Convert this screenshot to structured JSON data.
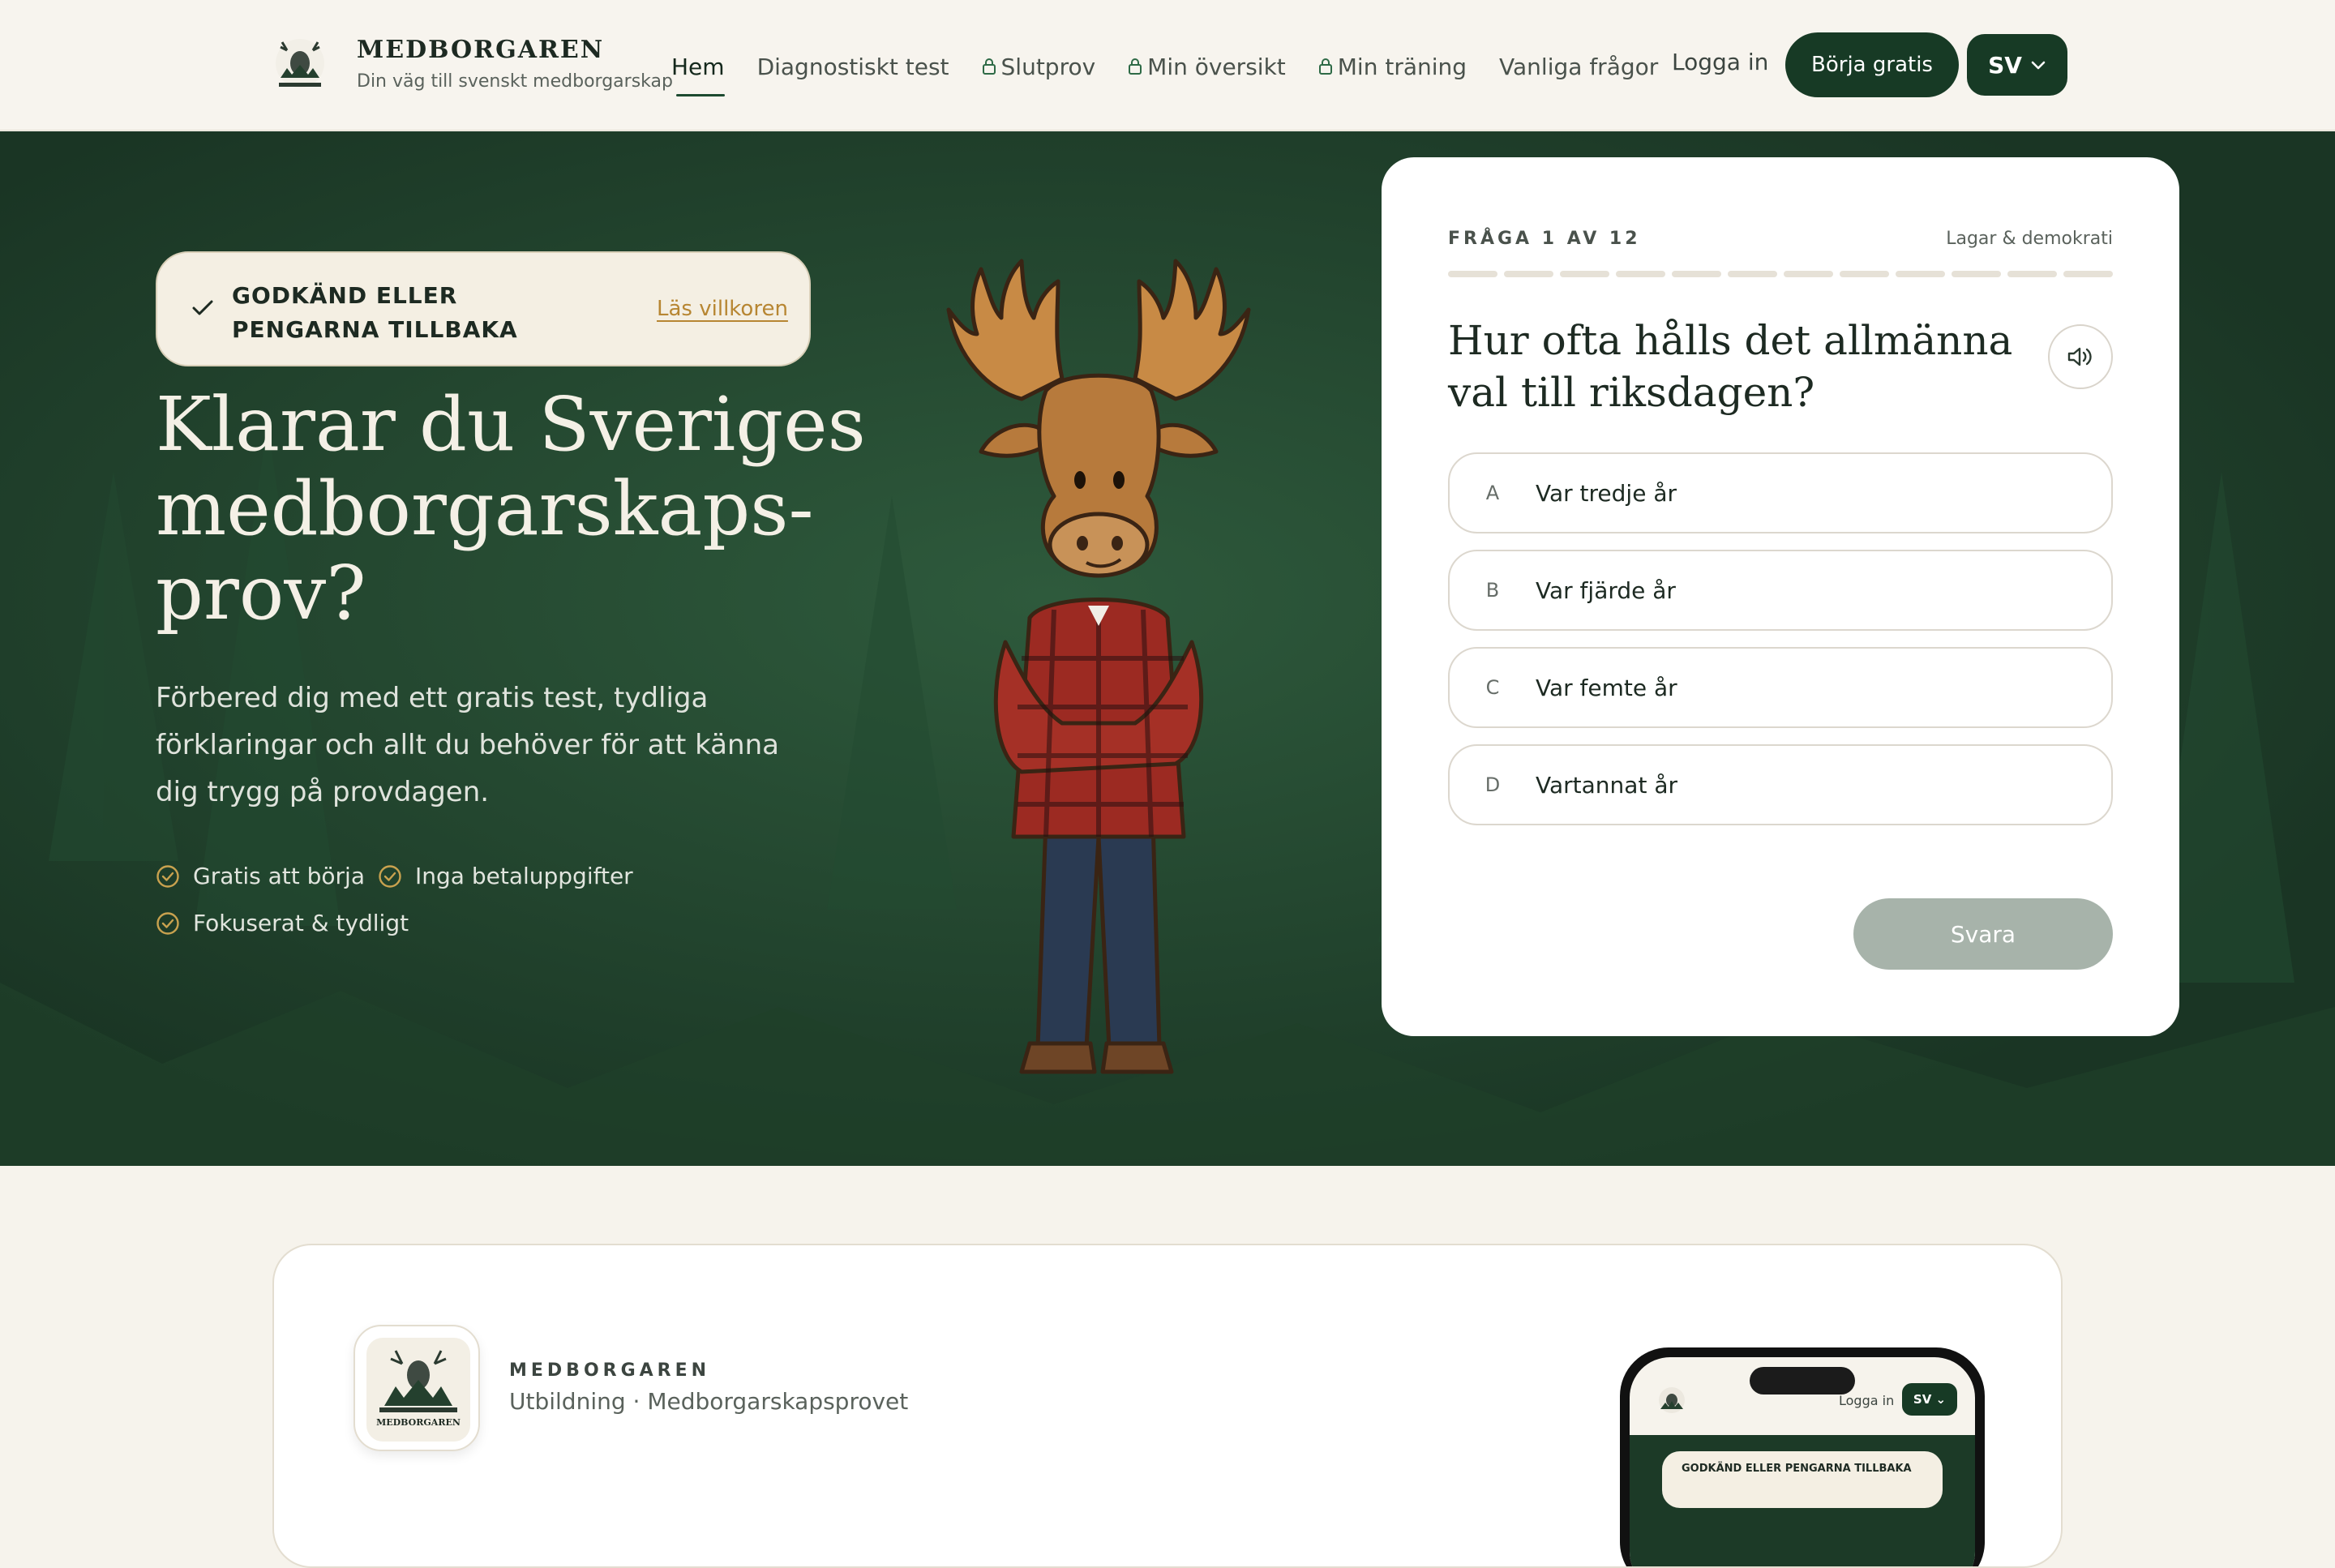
{
  "brand": {
    "name": "MEDBORGAREN",
    "tagline": "Din väg till svenskt medborgarskap",
    "logo_text": "MEDBORGAREN"
  },
  "nav": {
    "items": [
      {
        "label": "Hem",
        "locked": false,
        "active": true
      },
      {
        "label": "Diagnostiskt test",
        "locked": false,
        "active": false
      },
      {
        "label": "Slutprov",
        "locked": true,
        "active": false
      },
      {
        "label": "Min översikt",
        "locked": true,
        "active": false
      },
      {
        "label": "Min träning",
        "locked": true,
        "active": false
      },
      {
        "label": "Vanliga frågor",
        "locked": false,
        "active": false
      }
    ],
    "login": "Logga in",
    "cta": "Börja gratis",
    "language": "SV"
  },
  "hero": {
    "guarantee": "GODKÄND ELLER PENGARNA TILLBAKA",
    "terms_link": "Läs villkoren",
    "title": "Klarar du Sveriges medborgarskaps-prov?",
    "subtitle": "Förbered dig med ett gratis test, tydliga förklaringar och allt du behöver för att känna dig trygg på provdagen.",
    "features": [
      "Gratis att börja",
      "Inga betaluppgifter",
      "Fokuserat & tydligt"
    ]
  },
  "quiz": {
    "counter": "FRÅGA 1 AV 12",
    "category": "Lagar & demokrati",
    "total_questions": 12,
    "current_question": 1,
    "question": "Hur ofta hålls det allmänna val till riksdagen?",
    "options": [
      {
        "letter": "A",
        "text": "Var tredje år"
      },
      {
        "letter": "B",
        "text": "Var fjärde år"
      },
      {
        "letter": "C",
        "text": "Var femte år"
      },
      {
        "letter": "D",
        "text": "Vartannat år"
      }
    ],
    "submit": "Svara"
  },
  "app_card": {
    "name": "MEDBORGAREN",
    "description": "Utbildning · Medborgarskapsprovet",
    "phone_login": "Logga in",
    "phone_lang": "SV",
    "phone_guarantee": "GODKÄND ELLER PENGARNA TILLBAKA"
  },
  "colors": {
    "primary_dark_green": "#173a25",
    "hero_green": "#1c3a27",
    "accent_gold": "#b78632",
    "cream": "#f4efe3",
    "page_bg": "#f6f3ec",
    "disabled_button": "#a7b3aa"
  },
  "icons": {
    "lock": "lock-icon",
    "check": "check-icon",
    "check_circle": "check-circle-icon",
    "audio": "speaker-icon",
    "chevron": "chevron-down-icon",
    "mascot": "moose-mascot"
  }
}
